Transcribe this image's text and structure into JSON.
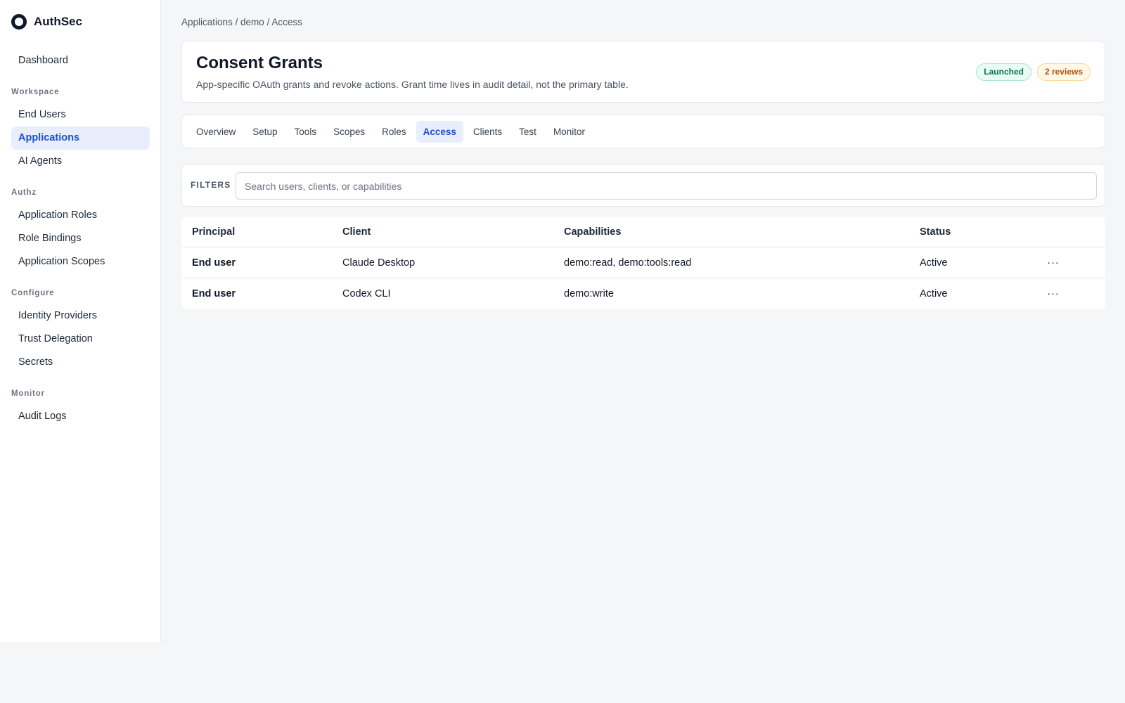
{
  "brand": {
    "name": "AuthSec"
  },
  "sidebar": {
    "top_item": "Dashboard",
    "sections": [
      {
        "title": "Workspace",
        "items": [
          "End Users",
          "Applications",
          "AI Agents"
        ]
      },
      {
        "title": "Authz",
        "items": [
          "Application Roles",
          "Role Bindings",
          "Application Scopes"
        ]
      },
      {
        "title": "Configure",
        "items": [
          "Identity Providers",
          "Trust Delegation",
          "Secrets"
        ]
      },
      {
        "title": "Monitor",
        "items": [
          "Audit Logs"
        ]
      }
    ],
    "active_item": "Applications"
  },
  "breadcrumb": "Applications / demo / Access",
  "header": {
    "title": "Consent Grants",
    "subtitle": "App-specific OAuth grants and revoke actions. Grant time lives in audit detail, not the primary table.",
    "badges": {
      "launched": "Launched",
      "reviews": "2 reviews"
    }
  },
  "tabs": [
    "Overview",
    "Setup",
    "Tools",
    "Scopes",
    "Roles",
    "Access",
    "Clients",
    "Test",
    "Monitor"
  ],
  "active_tab": "Access",
  "filters": {
    "label": "FILTERS",
    "search_placeholder": "Search users, clients, or capabilities",
    "search_value": ""
  },
  "table": {
    "columns": [
      "Principal",
      "Client",
      "Capabilities",
      "Status"
    ],
    "rows": [
      {
        "principal": "End user",
        "client": "Claude Desktop",
        "capabilities": "demo:read, demo:tools:read",
        "status": "Active",
        "action": "···"
      },
      {
        "principal": "End user",
        "client": "Codex CLI",
        "capabilities": "demo:write",
        "status": "Active",
        "action": "···"
      }
    ]
  },
  "icons": {
    "brand": "ring-logo-icon",
    "row_action": "more-horizontal-icon"
  },
  "colors": {
    "accent": "#1d4ed8",
    "accent_bg": "#e8eefb",
    "success": "#047857",
    "warning": "#b45309"
  }
}
